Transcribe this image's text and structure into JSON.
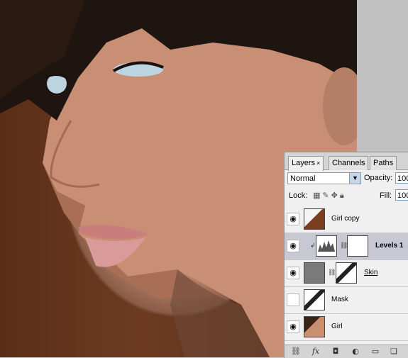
{
  "tabs": [
    {
      "label": "Layers",
      "close": "×",
      "active": true
    },
    {
      "label": "Channels",
      "active": false
    },
    {
      "label": "Paths",
      "active": false
    }
  ],
  "blend_mode": "Normal",
  "opacity_label": "Opacity:",
  "opacity_value": "100",
  "lock_label": "Lock:",
  "fill_label": "Fill:",
  "fill_value": "100",
  "layers": [
    {
      "name": "Girl copy",
      "visible": true,
      "selected": false
    },
    {
      "name": "Levels 1",
      "visible": true,
      "selected": true
    },
    {
      "name": "Skin",
      "visible": true,
      "selected": false
    },
    {
      "name": "Mask",
      "visible": false,
      "selected": false
    },
    {
      "name": "Girl",
      "visible": true,
      "selected": false
    }
  ],
  "icons": {
    "eye": "eye-icon",
    "link": "link-icon",
    "fx": "fx-icon",
    "mask": "mask-icon",
    "adjustment": "adjustment-icon",
    "group": "folder-icon",
    "new": "new-layer-icon"
  }
}
